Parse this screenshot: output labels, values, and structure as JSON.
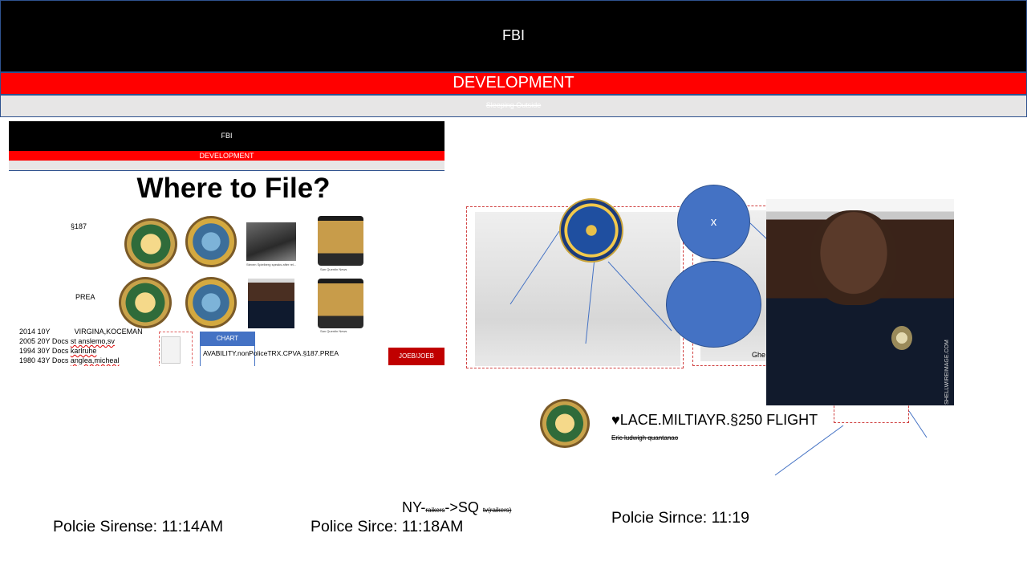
{
  "header": {
    "title": "FBI",
    "band_title": "DEVELOPMENT",
    "subtitle_struck": "Sleeping Outside"
  },
  "slide": {
    "header_title": "FBI",
    "band_title": "DEVELOPMENT",
    "heading": "Where to File?",
    "row_labels": [
      "§187",
      "PREA"
    ],
    "photo_captions": [
      "Steven Spielberg speaks after rel...",
      "San Quentin News",
      "San Quentin News"
    ],
    "docs": [
      {
        "line": "2014 10Y",
        "detail": "VIRGINA,KOCEMAN"
      },
      {
        "line": "2005 20Y Docs",
        "detail": "st anslemo,sv"
      },
      {
        "line": "1994 30Y Docs",
        "detail": "karlruhe"
      },
      {
        "line": "1980 43Y Docs",
        "detail": "anglea,micheal"
      }
    ],
    "chart_button": "CHART",
    "availability": "AVABILITY.nonPoliceTRX.CPVA.§187.PREA",
    "joeb_button": "JOEB/JOEB"
  },
  "collage": {
    "circle_label": "x",
    "gheo": "Ghe",
    "watermark": "SHELLWIREIMAGE.COM",
    "flight_text": "♥LACE.MILTIAYR.§250 FLIGHT",
    "flight_sub": "Eric ludwigh quantanao"
  },
  "bottom": {
    "left": "Polcie Sirense: 11:14AM",
    "middle": "Police Sirce: 11:18AM",
    "right": "Polcie Sirnce: 11:19",
    "ny_start": "NY-",
    "ny_struck": "raikers",
    "ny_arrow": "->SQ",
    "ny_tail": "tv(raikers)"
  },
  "colors": {
    "banner": "#000000",
    "band": "#ff0000",
    "grey_band": "#e7e6e6",
    "accent_blue": "#4472c4",
    "button_red": "#c00000"
  }
}
